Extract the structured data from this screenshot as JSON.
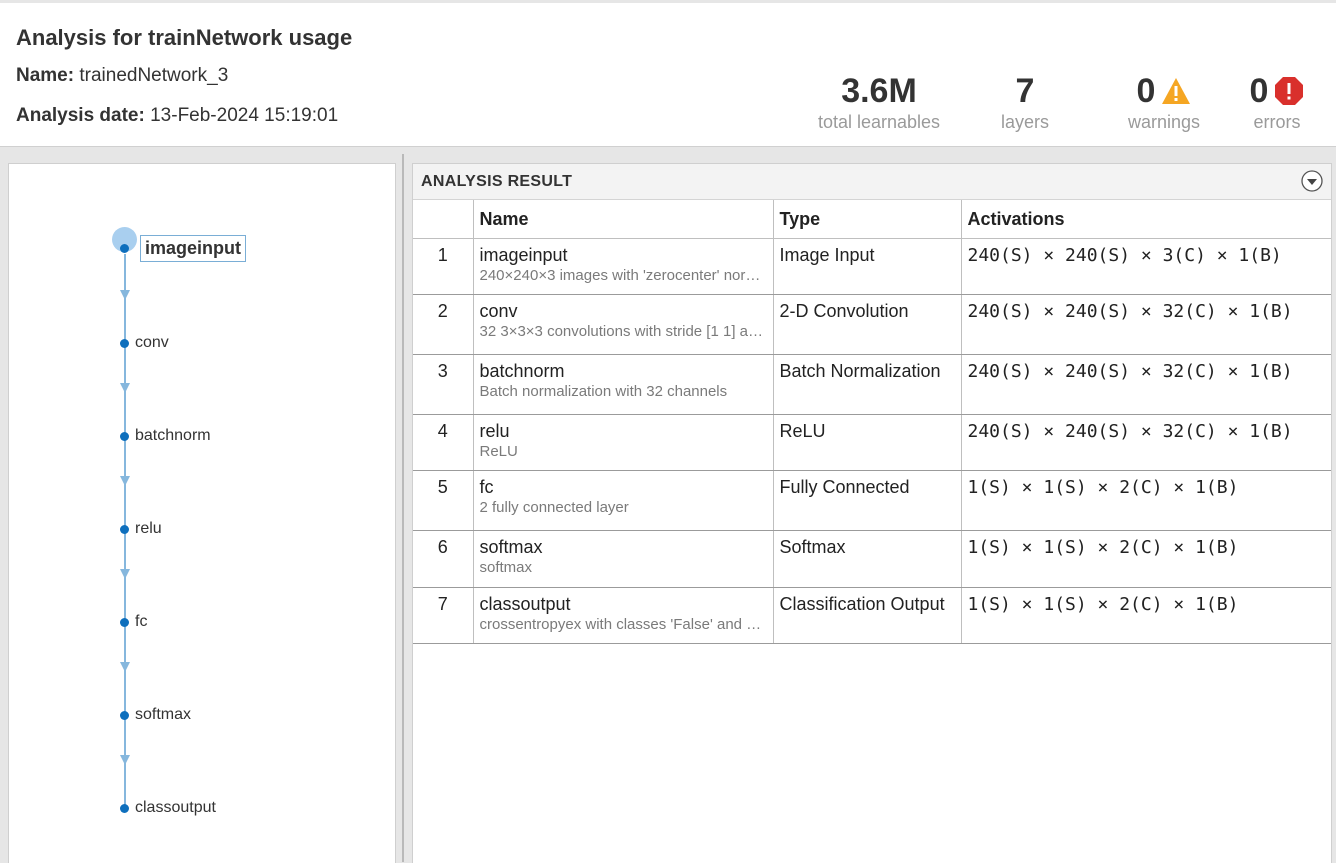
{
  "header": {
    "title": "Analysis for trainNetwork usage",
    "name_label": "Name:",
    "name_value": "trainedNetwork_3",
    "date_label": "Analysis date:",
    "date_value": "13-Feb-2024 15:19:01"
  },
  "stats": {
    "learnables_value": "3.6M",
    "learnables_label": "total learnables",
    "layers_value": "7",
    "layers_label": "layers",
    "warnings_value": "0",
    "warnings_label": "warnings",
    "errors_value": "0",
    "errors_label": "errors"
  },
  "graph": {
    "nodes": [
      "imageinput",
      "conv",
      "batchnorm",
      "relu",
      "fc",
      "softmax",
      "classoutput"
    ],
    "selected": "imageinput"
  },
  "results": {
    "section_title": "ANALYSIS RESULT",
    "columns": {
      "index": "",
      "name": "Name",
      "type": "Type",
      "activations": "Activations"
    },
    "rows": [
      {
        "index": "1",
        "name": "imageinput",
        "desc": "240×240×3 images with 'zerocenter' nor…",
        "type": "Image Input",
        "activations": "240(S) × 240(S) × 3(C) × 1(B)"
      },
      {
        "index": "2",
        "name": "conv",
        "desc": "32 3×3×3 convolutions with stride [1 1] a…",
        "type": "2-D Convolution",
        "activations": "240(S) × 240(S) × 32(C) × 1(B)"
      },
      {
        "index": "3",
        "name": "batchnorm",
        "desc": "Batch normalization with 32 channels",
        "type": "Batch Normalization",
        "activations": "240(S) × 240(S) × 32(C) × 1(B)"
      },
      {
        "index": "4",
        "name": "relu",
        "desc": "ReLU",
        "type": "ReLU",
        "activations": "240(S) × 240(S) × 32(C) × 1(B)"
      },
      {
        "index": "5",
        "name": "fc",
        "desc": "2 fully connected layer",
        "type": "Fully Connected",
        "activations": "1(S) × 1(S) × 2(C) × 1(B)"
      },
      {
        "index": "6",
        "name": "softmax",
        "desc": "softmax",
        "type": "Softmax",
        "activations": "1(S) × 1(S) × 2(C) × 1(B)"
      },
      {
        "index": "7",
        "name": "classoutput",
        "desc": "crossentropyex with classes 'False' and …",
        "type": "Classification Output",
        "activations": "1(S) × 1(S) × 2(C) × 1(B)"
      }
    ]
  },
  "colors": {
    "node_blue": "#0e6fbd",
    "edge_blue": "#86b7dd",
    "warning": "#f5a623",
    "error": "#d9302c"
  }
}
